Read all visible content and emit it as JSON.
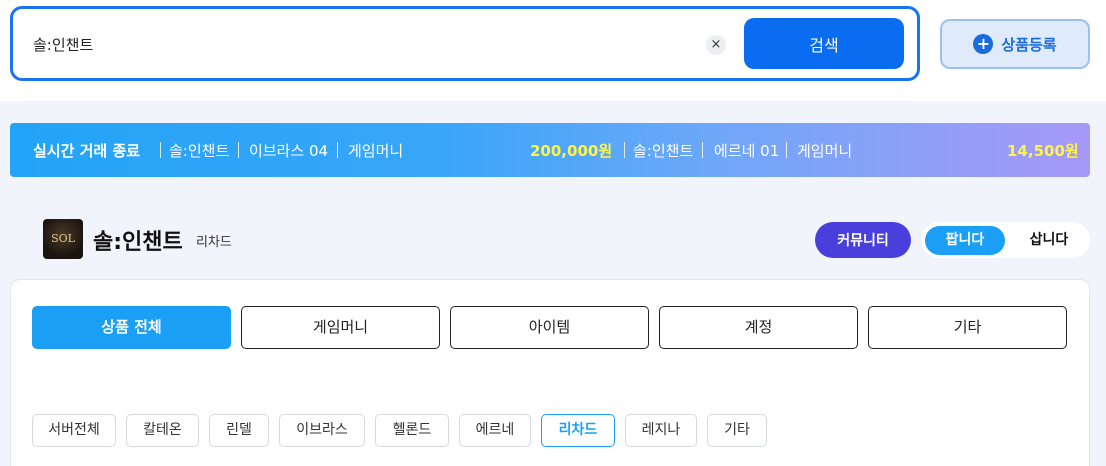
{
  "search": {
    "value": "솔:인챈트",
    "clear_label": "×",
    "button_label": "검색"
  },
  "register": {
    "plus": "+",
    "label": "상품등록"
  },
  "ticker": {
    "title": "실시간 거래 종료",
    "items": [
      {
        "server": "솔:인챈트",
        "world": "이브라스 04",
        "type": "게임머니",
        "price": "200,000원"
      },
      {
        "server": "솔:인챈트",
        "world": "에르네 01",
        "type": "게임머니",
        "price": "14,500원"
      }
    ]
  },
  "server": {
    "logo_text": "SOL",
    "name": "솔:인챈트",
    "world": "리차드"
  },
  "actions": {
    "community": "커뮤니티",
    "sell": "팝니다",
    "buy": "삽니다"
  },
  "categories": [
    "상품 전체",
    "게임머니",
    "아이템",
    "계정",
    "기타"
  ],
  "active_category": 0,
  "servers": [
    "서버전체",
    "칼테온",
    "린델",
    "이브라스",
    "헬론드",
    "에르네",
    "리차드",
    "레지나",
    "기타"
  ],
  "active_server": 6,
  "colors": {
    "accent": "#1a9ff5",
    "primary": "#0a6cf0",
    "community": "#4a3fdc",
    "price_highlight": "#fff44a"
  }
}
